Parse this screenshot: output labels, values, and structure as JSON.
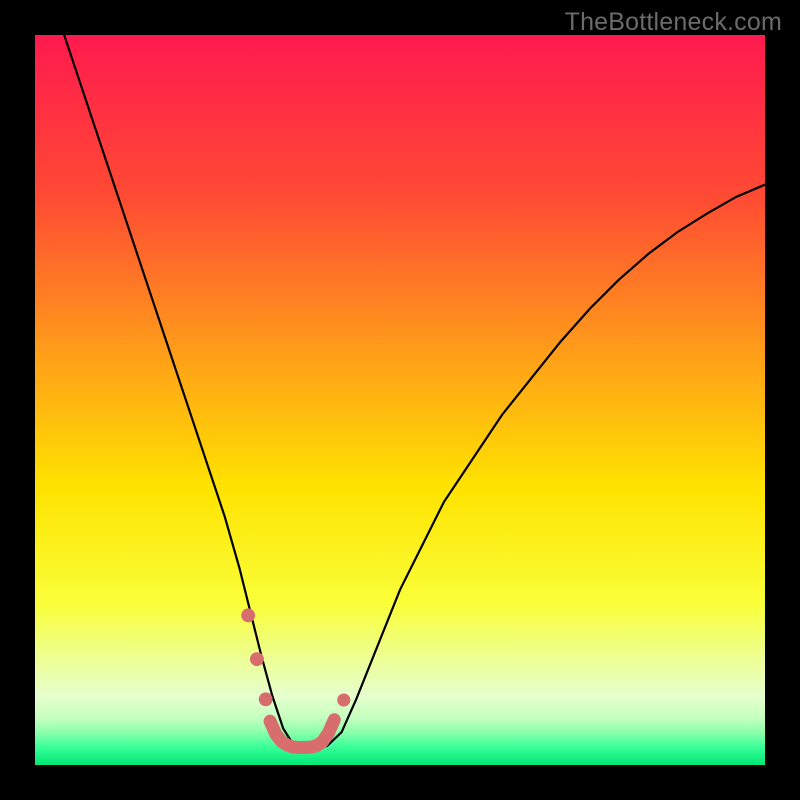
{
  "watermark": "TheBottleneck.com",
  "chart_data": {
    "type": "line",
    "title": "",
    "xlabel": "",
    "ylabel": "",
    "xlim": [
      0,
      100
    ],
    "ylim": [
      0,
      100
    ],
    "gradient_stops": [
      {
        "offset": 0,
        "color": "#ff1a4e"
      },
      {
        "offset": 0.22,
        "color": "#ff4a34"
      },
      {
        "offset": 0.45,
        "color": "#ffa317"
      },
      {
        "offset": 0.62,
        "color": "#ffe300"
      },
      {
        "offset": 0.78,
        "color": "#f9ff3a"
      },
      {
        "offset": 0.86,
        "color": "#ecff9a"
      },
      {
        "offset": 0.905,
        "color": "#e6ffce"
      },
      {
        "offset": 0.935,
        "color": "#c6ffbf"
      },
      {
        "offset": 0.955,
        "color": "#8dffab"
      },
      {
        "offset": 0.975,
        "color": "#3bff9a"
      },
      {
        "offset": 1.0,
        "color": "#00e873"
      }
    ],
    "series": [
      {
        "name": "bottleneck-curve",
        "x": [
          4,
          6,
          8,
          10,
          12,
          14,
          16,
          18,
          20,
          22,
          24,
          26,
          28,
          29.5,
          31,
          32.5,
          34,
          35.5,
          36.5,
          38,
          40,
          42,
          44,
          46,
          48,
          50,
          53,
          56,
          60,
          64,
          68,
          72,
          76,
          80,
          84,
          88,
          92,
          96,
          100
        ],
        "y": [
          100,
          94,
          88,
          82,
          76,
          70,
          64,
          58,
          52,
          46,
          40,
          34,
          27,
          21,
          15,
          9.5,
          5.0,
          2.6,
          2.4,
          2.4,
          2.6,
          4.5,
          9.0,
          14,
          19,
          24,
          30,
          36,
          42,
          48,
          53,
          58,
          62.5,
          66.5,
          70,
          73,
          75.5,
          77.8,
          79.5
        ]
      }
    ],
    "highlight": {
      "color": "#d76d6d",
      "dots": [
        {
          "x": 29.2,
          "y": 20.5,
          "r": 0.95
        },
        {
          "x": 30.4,
          "y": 14.5,
          "r": 0.95
        },
        {
          "x": 31.6,
          "y": 9.0,
          "r": 0.95
        },
        {
          "x": 42.3,
          "y": 8.9,
          "r": 0.9
        }
      ],
      "segment": {
        "x": [
          32.2,
          33.0,
          33.8,
          34.6,
          35.4,
          36.2,
          37.0,
          37.8,
          38.6,
          39.4,
          40.2,
          41.0
        ],
        "y": [
          6.0,
          4.2,
          3.2,
          2.7,
          2.45,
          2.4,
          2.4,
          2.45,
          2.65,
          3.2,
          4.4,
          6.2
        ]
      }
    }
  }
}
